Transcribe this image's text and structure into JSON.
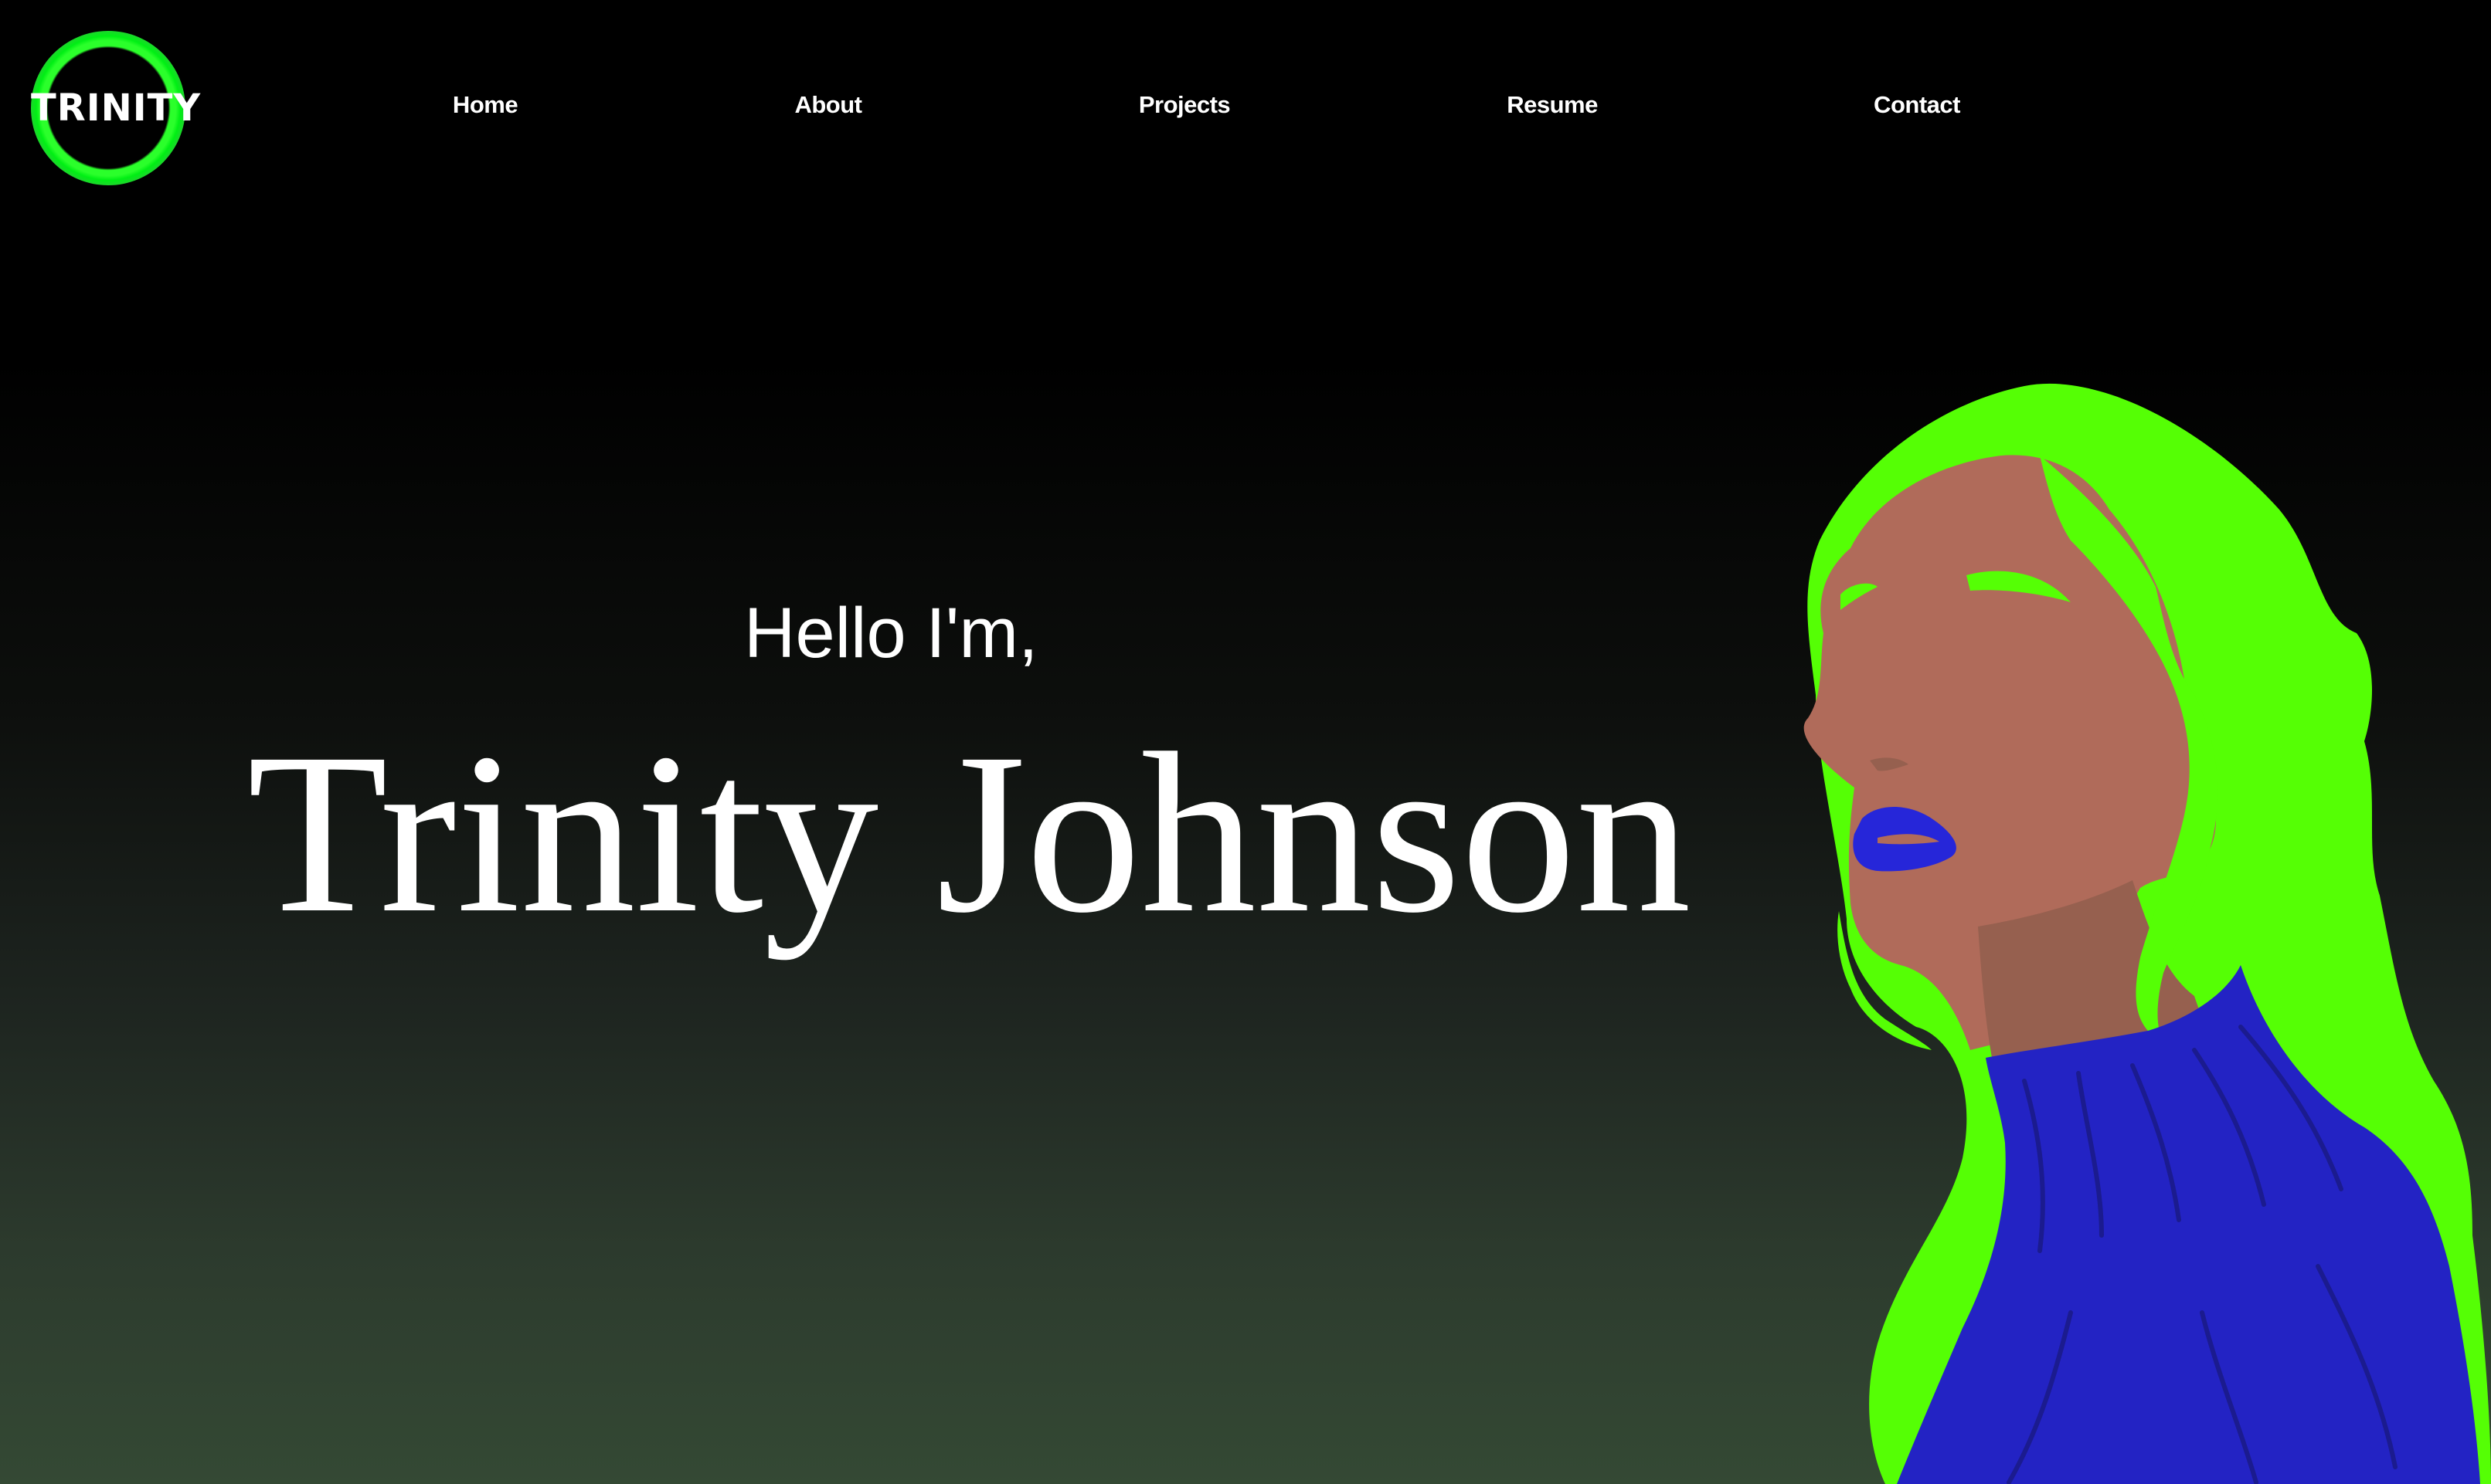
{
  "logo": {
    "text": "TRINITY"
  },
  "nav": {
    "items": [
      {
        "label": "Home"
      },
      {
        "label": "About"
      },
      {
        "label": "Projects"
      },
      {
        "label": "Resume"
      },
      {
        "label": "Contact"
      }
    ]
  },
  "hero": {
    "greeting": "Hello I'm,",
    "name": "Trinity Johnson"
  },
  "colors": {
    "accent_green": "#55ff05",
    "sweater_blue": "#2323c4",
    "lip_blue": "#2626d9",
    "skin": "#b06b5a",
    "skin_shadow": "#96604f",
    "background_top": "#000000",
    "background_bottom": "#344934"
  },
  "illustration": {
    "icon": "woman-portrait-illustration"
  }
}
